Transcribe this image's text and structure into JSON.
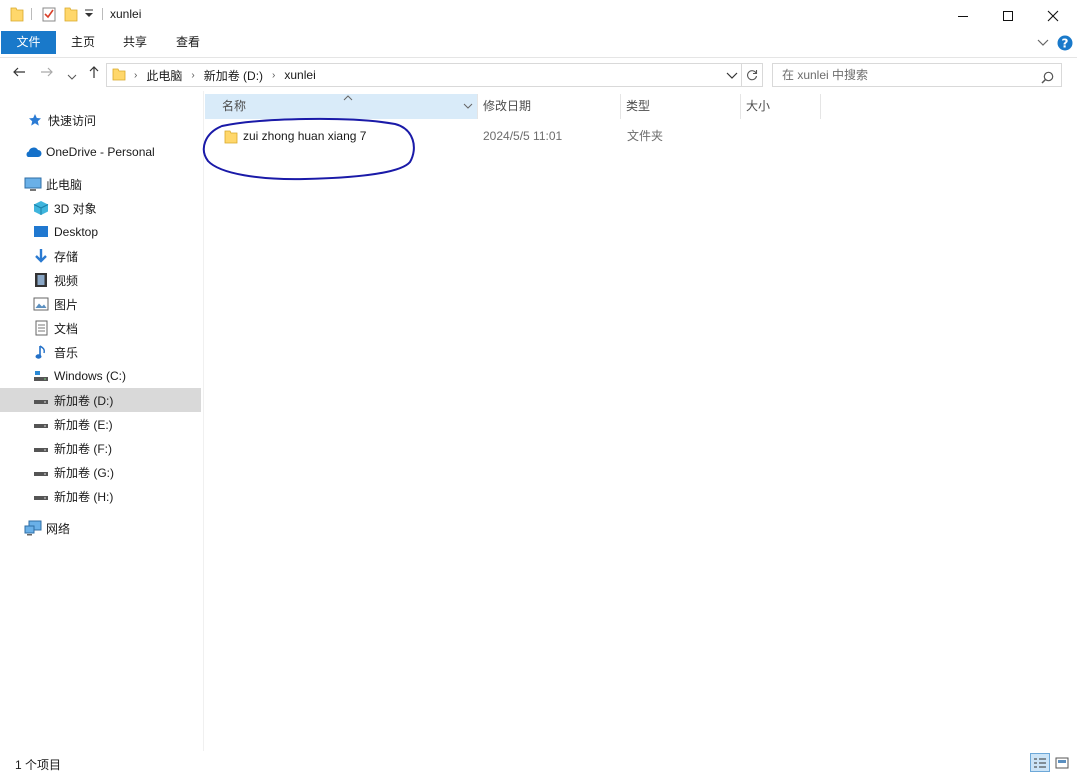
{
  "window": {
    "title": "xunlei",
    "minimize_icon": "minimize-icon",
    "maximize_icon": "maximize-icon",
    "close_icon": "close-icon"
  },
  "ribbon": {
    "tabs": [
      {
        "label": "文件"
      },
      {
        "label": "主页"
      },
      {
        "label": "共享"
      },
      {
        "label": "查看"
      }
    ]
  },
  "address": {
    "breadcrumbs": [
      "此电脑",
      "新加卷 (D:)",
      "xunlei"
    ],
    "search_placeholder": "在 xunlei 中搜索"
  },
  "sidebar": {
    "items": [
      {
        "label": "快速访问",
        "icon": "star-icon"
      },
      {
        "label": "OneDrive - Personal",
        "icon": "cloud-icon"
      },
      {
        "label": "此电脑",
        "icon": "computer-icon"
      },
      {
        "label": "3D 对象",
        "icon": "cube-icon"
      },
      {
        "label": "Desktop",
        "icon": "desktop-icon"
      },
      {
        "label": "存储",
        "icon": "download-icon"
      },
      {
        "label": "视频",
        "icon": "video-icon"
      },
      {
        "label": "图片",
        "icon": "picture-icon"
      },
      {
        "label": "文档",
        "icon": "document-icon"
      },
      {
        "label": "音乐",
        "icon": "music-icon"
      },
      {
        "label": "Windows (C:)",
        "icon": "system-drive-icon"
      },
      {
        "label": "新加卷 (D:)",
        "icon": "drive-icon"
      },
      {
        "label": "新加卷 (E:)",
        "icon": "drive-icon"
      },
      {
        "label": "新加卷 (F:)",
        "icon": "drive-icon"
      },
      {
        "label": "新加卷 (G:)",
        "icon": "drive-icon"
      },
      {
        "label": "新加卷 (H:)",
        "icon": "drive-icon"
      },
      {
        "label": "网络",
        "icon": "network-icon"
      }
    ],
    "selected": "新加卷 (D:)"
  },
  "columns": {
    "name": "名称",
    "modified": "修改日期",
    "type": "类型",
    "size": "大小"
  },
  "files": [
    {
      "name": "zui zhong huan xiang 7",
      "modified": "2024/5/5 11:01",
      "type": "文件夹",
      "size": ""
    }
  ],
  "status": {
    "count": "1 个项目"
  },
  "colors": {
    "file_tab": "#1979ca",
    "annotation": "#1a1aa8",
    "selected_nav": "#d9d9d9",
    "sorted_header": "#d9ebf9"
  }
}
